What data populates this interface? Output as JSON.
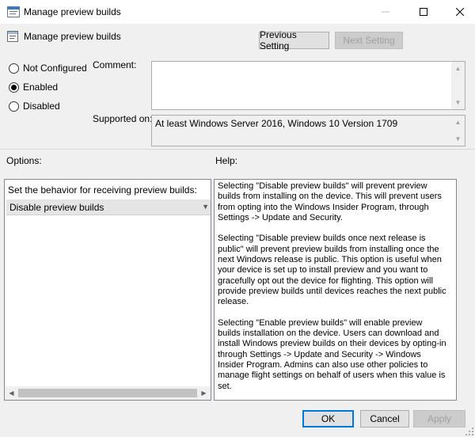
{
  "window": {
    "title": "Manage preview builds",
    "icons": {
      "title": "policy-window-icon",
      "minimize": "minimize-icon",
      "maximize": "maximize-icon",
      "close": "close-icon"
    }
  },
  "header": {
    "title": "Manage preview builds",
    "previous_label": "Previous Setting",
    "next_label": "Next Setting"
  },
  "state": {
    "options": [
      {
        "label": "Not Configured",
        "selected": false
      },
      {
        "label": "Enabled",
        "selected": true
      },
      {
        "label": "Disabled",
        "selected": false
      }
    ]
  },
  "comment": {
    "label": "Comment:",
    "value": ""
  },
  "supported": {
    "label": "Supported on:",
    "value": "At least Windows Server 2016, Windows 10 Version 1709"
  },
  "options_panel": {
    "heading": "Options:",
    "behavior_label": "Set the behavior for receiving preview builds:",
    "selected_value": "Disable preview builds"
  },
  "help_panel": {
    "heading": "Help:",
    "paragraphs": [
      "Selecting \"Disable preview builds\" will prevent preview builds from installing on the device. This will prevent users from opting into the Windows Insider Program, through Settings -> Update and Security.",
      "Selecting \"Disable preview builds once next release is public\" will prevent preview builds from installing once the next Windows release is public. This option is useful when your device is set up to install preview and you want to gracefully opt out the device for flighting. This option will provide preview builds until devices reaches the next public release.",
      "Selecting \"Enable preview builds\" will enable preview builds installation on the device. Users can download and install Windows preview builds on their devices by opting-in through Settings -> Update and Security -> Windows Insider Program. Admins can also use other policies to manage flight settings on behalf of users when this value is set."
    ]
  },
  "footer": {
    "ok_label": "OK",
    "cancel_label": "Cancel",
    "apply_label": "Apply"
  },
  "colors": {
    "accent": "#0078d7",
    "dialog_bg": "#f0f0f0"
  }
}
